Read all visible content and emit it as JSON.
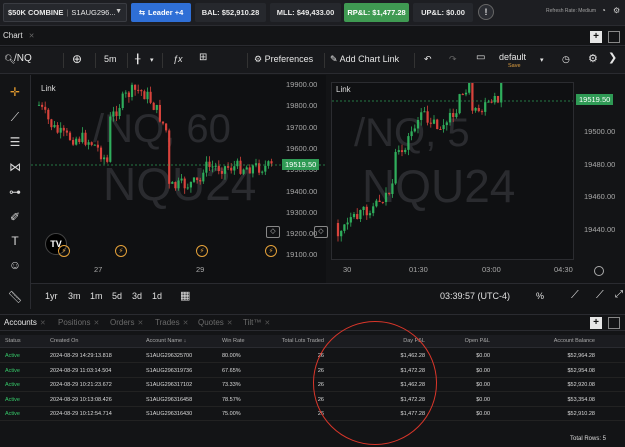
{
  "topbar": {
    "account_name": "$50K COMBINE",
    "account_number": "S1AUG296...",
    "leader_label": "Leader +4",
    "bal": "BAL: $52,910.28",
    "mll": "MLL: $49,433.00",
    "rpl": "RP&L: $1,477.28",
    "upl": "UP&L: $0.00",
    "refresh": "Refresh Rate: Medium",
    "colors": {
      "leader": "#2f6fd6",
      "rpl": "#3f9a52"
    }
  },
  "chart_tab": {
    "label": "Chart"
  },
  "chart_toolbar": {
    "symbol": "/NQ",
    "interval": "5m",
    "preferences": "Preferences",
    "add_link": "Add Chart Link",
    "layout": "default",
    "layout_status": "Save"
  },
  "left_pane": {
    "link_label": "Link",
    "watermark_symbol": "/NQ, 60",
    "watermark_contract": "NQU24",
    "price_tag": "19519.50",
    "yticks": [
      "19900.00",
      "19800.00",
      "19700.00",
      "19600.00",
      "19500.00",
      "19400.00",
      "19300.00",
      "19200.00",
      "19100.00"
    ],
    "xticks": [
      "27",
      "29"
    ]
  },
  "right_pane": {
    "link_label": "Link",
    "watermark_symbol": "/NQ, 5",
    "watermark_contract": "NQU24",
    "price_tag": "19519.50",
    "yticks": [
      "19500.00",
      "19480.00",
      "19460.00",
      "19440.00"
    ],
    "xticks": [
      "30",
      "01:30",
      "03:00",
      "04:30"
    ]
  },
  "range_bar": {
    "ranges": [
      "1yr",
      "3m",
      "1m",
      "5d",
      "3d",
      "1d"
    ],
    "time": "03:39:57 (UTC-4)",
    "percent": "%"
  },
  "bottom_tabs": [
    "Accounts",
    "Positions",
    "Orders",
    "Trades",
    "Quotes",
    "Tilt™"
  ],
  "accounts_table": {
    "columns": [
      "Status",
      "Created On",
      "Account Name",
      "Win Rate",
      "Total Lots Traded",
      "Day P&L",
      "Open P&L",
      "Account Balance"
    ],
    "rows": [
      [
        "Active",
        "2024-08-29 14:29:13.818",
        "S1AUG296325700",
        "80.00%",
        "26",
        "$1,462.28",
        "$0.00",
        "$52,964.28"
      ],
      [
        "Active",
        "2024-08-29 11:03:14.504",
        "S1AUG296319736",
        "67.65%",
        "26",
        "$1,472.28",
        "$0.00",
        "$52,954.08"
      ],
      [
        "Active",
        "2024-08-29 10:21:23.672",
        "S1AUG296317102",
        "73.33%",
        "26",
        "$1,462.28",
        "$0.00",
        "$52,920.08"
      ],
      [
        "Active",
        "2024-08-29 10:13:08.426",
        "S1AUG296316458",
        "78.57%",
        "26",
        "$1,472.28",
        "$0.00",
        "$53,354.08"
      ],
      [
        "Active",
        "2024-08-29 10:12:54.714",
        "S1AUG296316430",
        "75.00%",
        "26",
        "$1,477.28",
        "$0.00",
        "$52,910.28"
      ]
    ],
    "total_rows": "Total Rows: 5"
  }
}
